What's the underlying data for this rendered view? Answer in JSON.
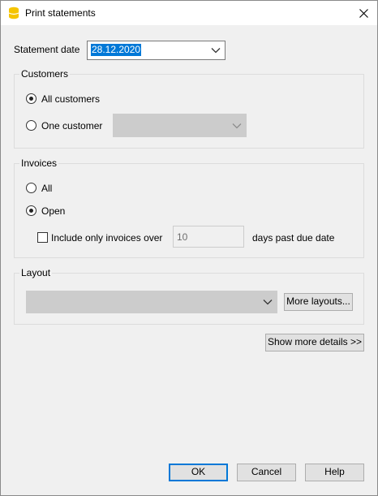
{
  "window": {
    "title": "Print statements"
  },
  "statement_date": {
    "label": "Statement date",
    "value": "28.12.2020"
  },
  "customers": {
    "group_title": "Customers",
    "all_label": "All customers",
    "one_label": "One customer",
    "selected": "all",
    "customer_value": ""
  },
  "invoices": {
    "group_title": "Invoices",
    "all_label": "All",
    "open_label": "Open",
    "selected": "open",
    "include_label": "Include only invoices over",
    "include_checked": false,
    "days_value": "10",
    "days_suffix": "days past due date"
  },
  "layout": {
    "group_title": "Layout",
    "selected_value": "",
    "more_layouts_label": "More layouts..."
  },
  "show_more_label": "Show more details >>",
  "footer": {
    "ok_label": "OK",
    "cancel_label": "Cancel",
    "help_label": "Help"
  },
  "colors": {
    "accent": "#0078d7",
    "window_bg": "#f0f0f0",
    "icon_yellow": "#f5c400"
  }
}
